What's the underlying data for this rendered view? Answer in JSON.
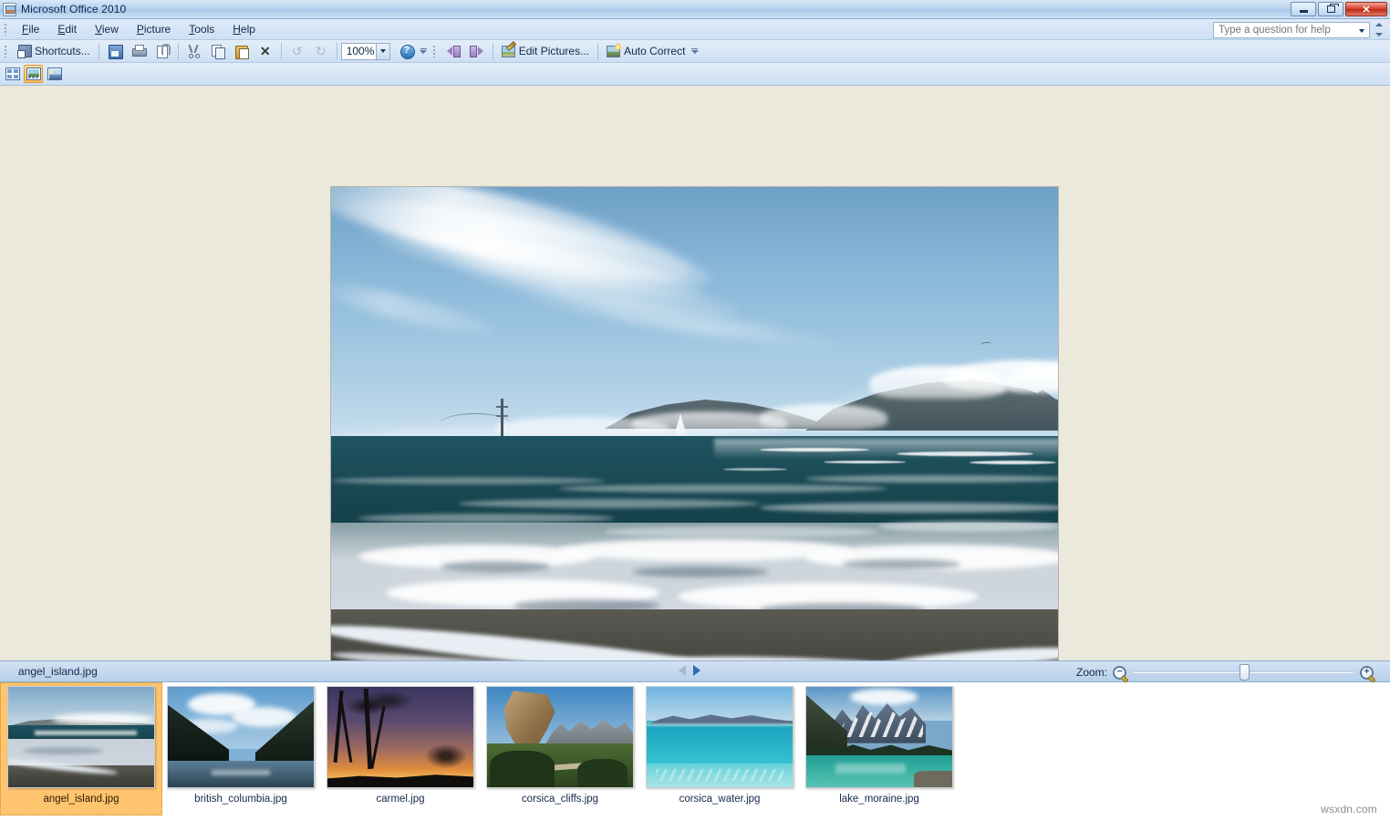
{
  "window": {
    "title": "Microsoft Office 2010",
    "app_icon": "picture-manager-icon",
    "minimize_label": "Minimize",
    "restore_label": "Restore",
    "close_label": "Close"
  },
  "menubar": {
    "items": [
      {
        "label": "File",
        "accel": "F"
      },
      {
        "label": "Edit",
        "accel": "E"
      },
      {
        "label": "View",
        "accel": "V"
      },
      {
        "label": "Picture",
        "accel": "P"
      },
      {
        "label": "Tools",
        "accel": "T"
      },
      {
        "label": "Help",
        "accel": "H"
      }
    ],
    "help_search": {
      "placeholder": "Type a question for help",
      "value": ""
    }
  },
  "toolbar": {
    "shortcuts_label": "Shortcuts...",
    "save_label": "Save",
    "print_label": "Print",
    "attach_label": "Send by e-mail",
    "cut_label": "Cut",
    "copy_label": "Copy",
    "paste_label": "Paste",
    "delete_label": "Delete",
    "undo_label": "Undo",
    "redo_label": "Redo",
    "zoom_value": "100%",
    "help_label": "Microsoft Office Picture Manager Help",
    "rotate_left_label": "Rotate Left",
    "rotate_right_label": "Rotate Right",
    "edit_pictures_label": "Edit Pictures...",
    "auto_correct_label": "Auto Correct",
    "overflow_label": "Toolbar Options"
  },
  "viewbar": {
    "thumbnail_view_label": "Thumbnail View",
    "filmstrip_view_label": "Filmstrip View",
    "single_picture_view_label": "Single Picture View",
    "active_view": "filmstrip"
  },
  "statusbar": {
    "filename": "angel_island.jpg",
    "previous_label": "Previous Item",
    "next_label": "Next Item",
    "zoom_label": "Zoom:",
    "zoom_out_label": "Zoom Out",
    "zoom_in_label": "Zoom In",
    "zoom_slider_value": 50
  },
  "thumbnails": [
    {
      "label": "angel_island.jpg",
      "selected": true,
      "scene": "beach"
    },
    {
      "label": "british_columbia.jpg",
      "selected": false,
      "scene": "fjord"
    },
    {
      "label": "carmel.jpg",
      "selected": false,
      "scene": "sunset"
    },
    {
      "label": "corsica_cliffs.jpg",
      "selected": false,
      "scene": "cliffs"
    },
    {
      "label": "corsica_water.jpg",
      "selected": false,
      "scene": "water"
    },
    {
      "label": "lake_moraine.jpg",
      "selected": false,
      "scene": "lake"
    }
  ],
  "main_image": {
    "name": "angel_island.jpg",
    "alt": "Ocean beach with breaking surf, foggy headlands and the Golden Gate Bridge tower under a blue sky",
    "accent_selection_color": "#ffc46e",
    "canvas_background": "#ebe9dc"
  },
  "watermark": "wsxdn.com"
}
